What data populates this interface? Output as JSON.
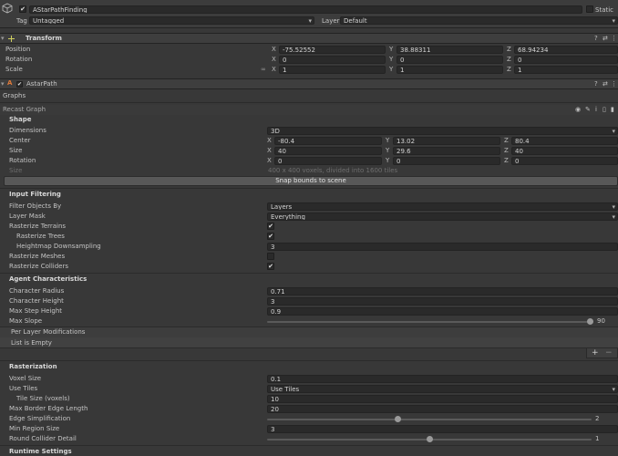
{
  "object": {
    "name": "AStarPathFinding",
    "static_label": "Static",
    "tag_label": "Tag",
    "tag_value": "Untagged",
    "layer_label": "Layer",
    "layer_value": "Default"
  },
  "transform": {
    "title": "Transform",
    "position_label": "Position",
    "rotation_label": "Rotation",
    "scale_label": "Scale",
    "position": {
      "x": "-75.52552",
      "y": "38.88311",
      "z": "68.94234"
    },
    "rotation": {
      "x": "0",
      "y": "0",
      "z": "0"
    },
    "scale": {
      "x": "1",
      "y": "1",
      "z": "1"
    }
  },
  "astar": {
    "title": "AstarPath",
    "graphs_label": "Graphs",
    "graph_name": "Recast Graph"
  },
  "shape": {
    "title": "Shape",
    "dimensions_label": "Dimensions",
    "dimensions_value": "3D",
    "center_label": "Center",
    "center": {
      "x": "-80.4",
      "y": "13.02",
      "z": "80.4"
    },
    "size_label": "Size",
    "size": {
      "x": "40",
      "y": "29.6",
      "z": "40"
    },
    "rotation_label": "Rotation",
    "rotation": {
      "x": "0",
      "y": "0",
      "z": "0"
    },
    "size2_label": "Size",
    "size_info": "400 x 400 voxels, divided into 1600 tiles",
    "snap_button": "Snap bounds to scene"
  },
  "input_filtering": {
    "title": "Input Filtering",
    "filter_label": "Filter Objects By",
    "filter_value": "Layers",
    "layer_mask_label": "Layer Mask",
    "layer_mask_value": "Everything",
    "rasterize_terrains_label": "Rasterize Terrains",
    "rasterize_trees_label": "Rasterize Trees",
    "heightmap_label": "Heightmap Downsampling",
    "heightmap_value": "3",
    "rasterize_meshes_label": "Rasterize Meshes",
    "rasterize_colliders_label": "Rasterize Colliders"
  },
  "agent": {
    "title": "Agent Characteristics",
    "radius_label": "Character Radius",
    "radius_value": "0.71",
    "height_label": "Character Height",
    "height_value": "3",
    "step_label": "Max Step Height",
    "step_value": "0.9",
    "slope_label": "Max Slope",
    "slope_value": "90",
    "slope_max": 90,
    "per_layer_label": "Per Layer Modifications",
    "list_empty": "List is Empty",
    "add": "+",
    "remove": "−"
  },
  "rasterization": {
    "title": "Rasterization",
    "voxel_label": "Voxel Size",
    "voxel_value": "0.1",
    "use_tiles_label": "Use Tiles",
    "use_tiles_value": "Use Tiles",
    "tile_size_label": "Tile Size (voxels)",
    "tile_size_value": "10",
    "border_label": "Max Border Edge Length",
    "border_value": "20",
    "edge_simp_label": "Edge Simplification",
    "edge_simp_value": "2",
    "min_region_label": "Min Region Size",
    "min_region_value": "3",
    "collider_detail_label": "Round Collider Detail",
    "collider_detail_value": "1"
  },
  "runtime": {
    "title": "Runtime Settings"
  }
}
